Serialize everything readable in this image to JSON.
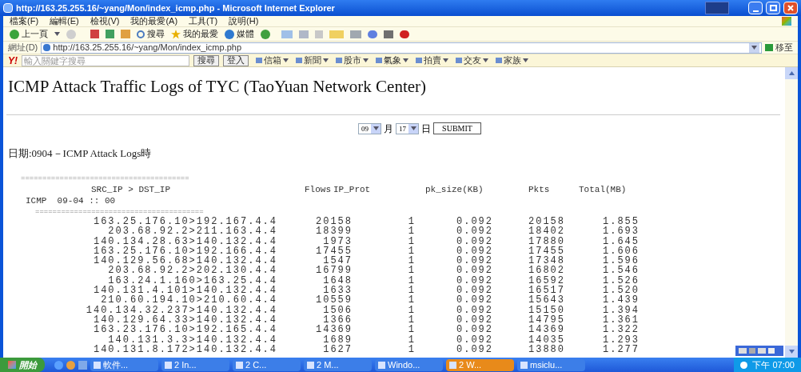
{
  "window": {
    "title": "http://163.25.255.16/~yang/Mon/index_icmp.php - Microsoft Internet Explorer"
  },
  "menu_bar": [
    "檔案(F)",
    "編輯(E)",
    "檢視(V)",
    "我的最愛(A)",
    "工具(T)",
    "說明(H)"
  ],
  "toolbar": {
    "back": "上一頁",
    "search": "搜尋",
    "favorites": "我的最愛",
    "media": "媒體"
  },
  "address_bar": {
    "label": "網址(D)",
    "url": "http://163.25.255.16/~yang/Mon/index_icmp.php",
    "go": "移至"
  },
  "yahoo_bar": {
    "logo": "Y!",
    "placeholder": "輸入關鍵字搜尋",
    "buttons": [
      "搜尋",
      "登入"
    ],
    "links": [
      "信箱",
      "新聞",
      "股市",
      "氣象",
      "拍賣",
      "交友",
      "家族"
    ]
  },
  "page": {
    "heading": "ICMP Attack Traffic Logs of TYC (TaoYuan Network Center)",
    "form": {
      "month": "09",
      "month_unit": "月",
      "day": "17",
      "day_unit": "日",
      "submit": "SUBMIT"
    },
    "date_line": "日期:0904－ICMP Attack Logs時",
    "log": {
      "rule_top": "=======================================",
      "columns": [
        "SRC_IP > DST_IP",
        "Flows",
        "IP_Prot",
        "pk_size(KB)",
        "Pkts",
        "Total(MB)"
      ],
      "group_line": "ICMP  09-04 :: 00",
      "rule_mid": "=======================================",
      "rows": [
        {
          "src_dst": "163.25.176.10>192.167.4.4",
          "flows": "20158",
          "ip_prot": "1",
          "pk_size": "0.092",
          "pkts": "20158",
          "total": "1.855"
        },
        {
          "src_dst": "203.68.92.2>211.163.4.4",
          "flows": "18399",
          "ip_prot": "1",
          "pk_size": "0.092",
          "pkts": "18402",
          "total": "1.693"
        },
        {
          "src_dst": "140.134.28.63>140.132.4.4",
          "flows": "1973",
          "ip_prot": "1",
          "pk_size": "0.092",
          "pkts": "17880",
          "total": "1.645"
        },
        {
          "src_dst": "163.25.176.10>192.166.4.4",
          "flows": "17455",
          "ip_prot": "1",
          "pk_size": "0.092",
          "pkts": "17455",
          "total": "1.606"
        },
        {
          "src_dst": "140.129.56.68>140.132.4.4",
          "flows": "1547",
          "ip_prot": "1",
          "pk_size": "0.092",
          "pkts": "17348",
          "total": "1.596"
        },
        {
          "src_dst": "203.68.92.2>202.130.4.4",
          "flows": "16799",
          "ip_prot": "1",
          "pk_size": "0.092",
          "pkts": "16802",
          "total": "1.546"
        },
        {
          "src_dst": "163.24.1.160>163.25.4.4",
          "flows": "1648",
          "ip_prot": "1",
          "pk_size": "0.092",
          "pkts": "16592",
          "total": "1.526"
        },
        {
          "src_dst": "140.131.4.101>140.132.4.4",
          "flows": "1633",
          "ip_prot": "1",
          "pk_size": "0.092",
          "pkts": "16517",
          "total": "1.520"
        },
        {
          "src_dst": "210.60.194.10>210.60.4.4",
          "flows": "10559",
          "ip_prot": "1",
          "pk_size": "0.092",
          "pkts": "15643",
          "total": "1.439"
        },
        {
          "src_dst": "140.134.32.237>140.132.4.4",
          "flows": "1506",
          "ip_prot": "1",
          "pk_size": "0.092",
          "pkts": "15150",
          "total": "1.394"
        },
        {
          "src_dst": "140.129.64.33>140.132.4.4",
          "flows": "1366",
          "ip_prot": "1",
          "pk_size": "0.092",
          "pkts": "14795",
          "total": "1.361"
        },
        {
          "src_dst": "163.23.176.10>192.165.4.4",
          "flows": "14369",
          "ip_prot": "1",
          "pk_size": "0.092",
          "pkts": "14369",
          "total": "1.322"
        },
        {
          "src_dst": "140.131.3.3>140.132.4.4",
          "flows": "1689",
          "ip_prot": "1",
          "pk_size": "0.092",
          "pkts": "14035",
          "total": "1.293"
        },
        {
          "src_dst": "140.131.8.172>140.132.4.4",
          "flows": "1627",
          "ip_prot": "1",
          "pk_size": "0.092",
          "pkts": "13880",
          "total": "1.277"
        }
      ]
    }
  },
  "taskbar": {
    "start": "開始",
    "tasks": [
      {
        "label": "軟件...",
        "selected": false
      },
      {
        "label": "2 In...",
        "selected": false
      },
      {
        "label": "2 C...",
        "selected": false
      },
      {
        "label": "2 M...",
        "selected": false
      },
      {
        "label": "Windo...",
        "selected": false
      },
      {
        "label": "2 W...",
        "selected": true
      },
      {
        "label": "msiclu...",
        "selected": false
      }
    ],
    "clock": "下午 07:00"
  }
}
